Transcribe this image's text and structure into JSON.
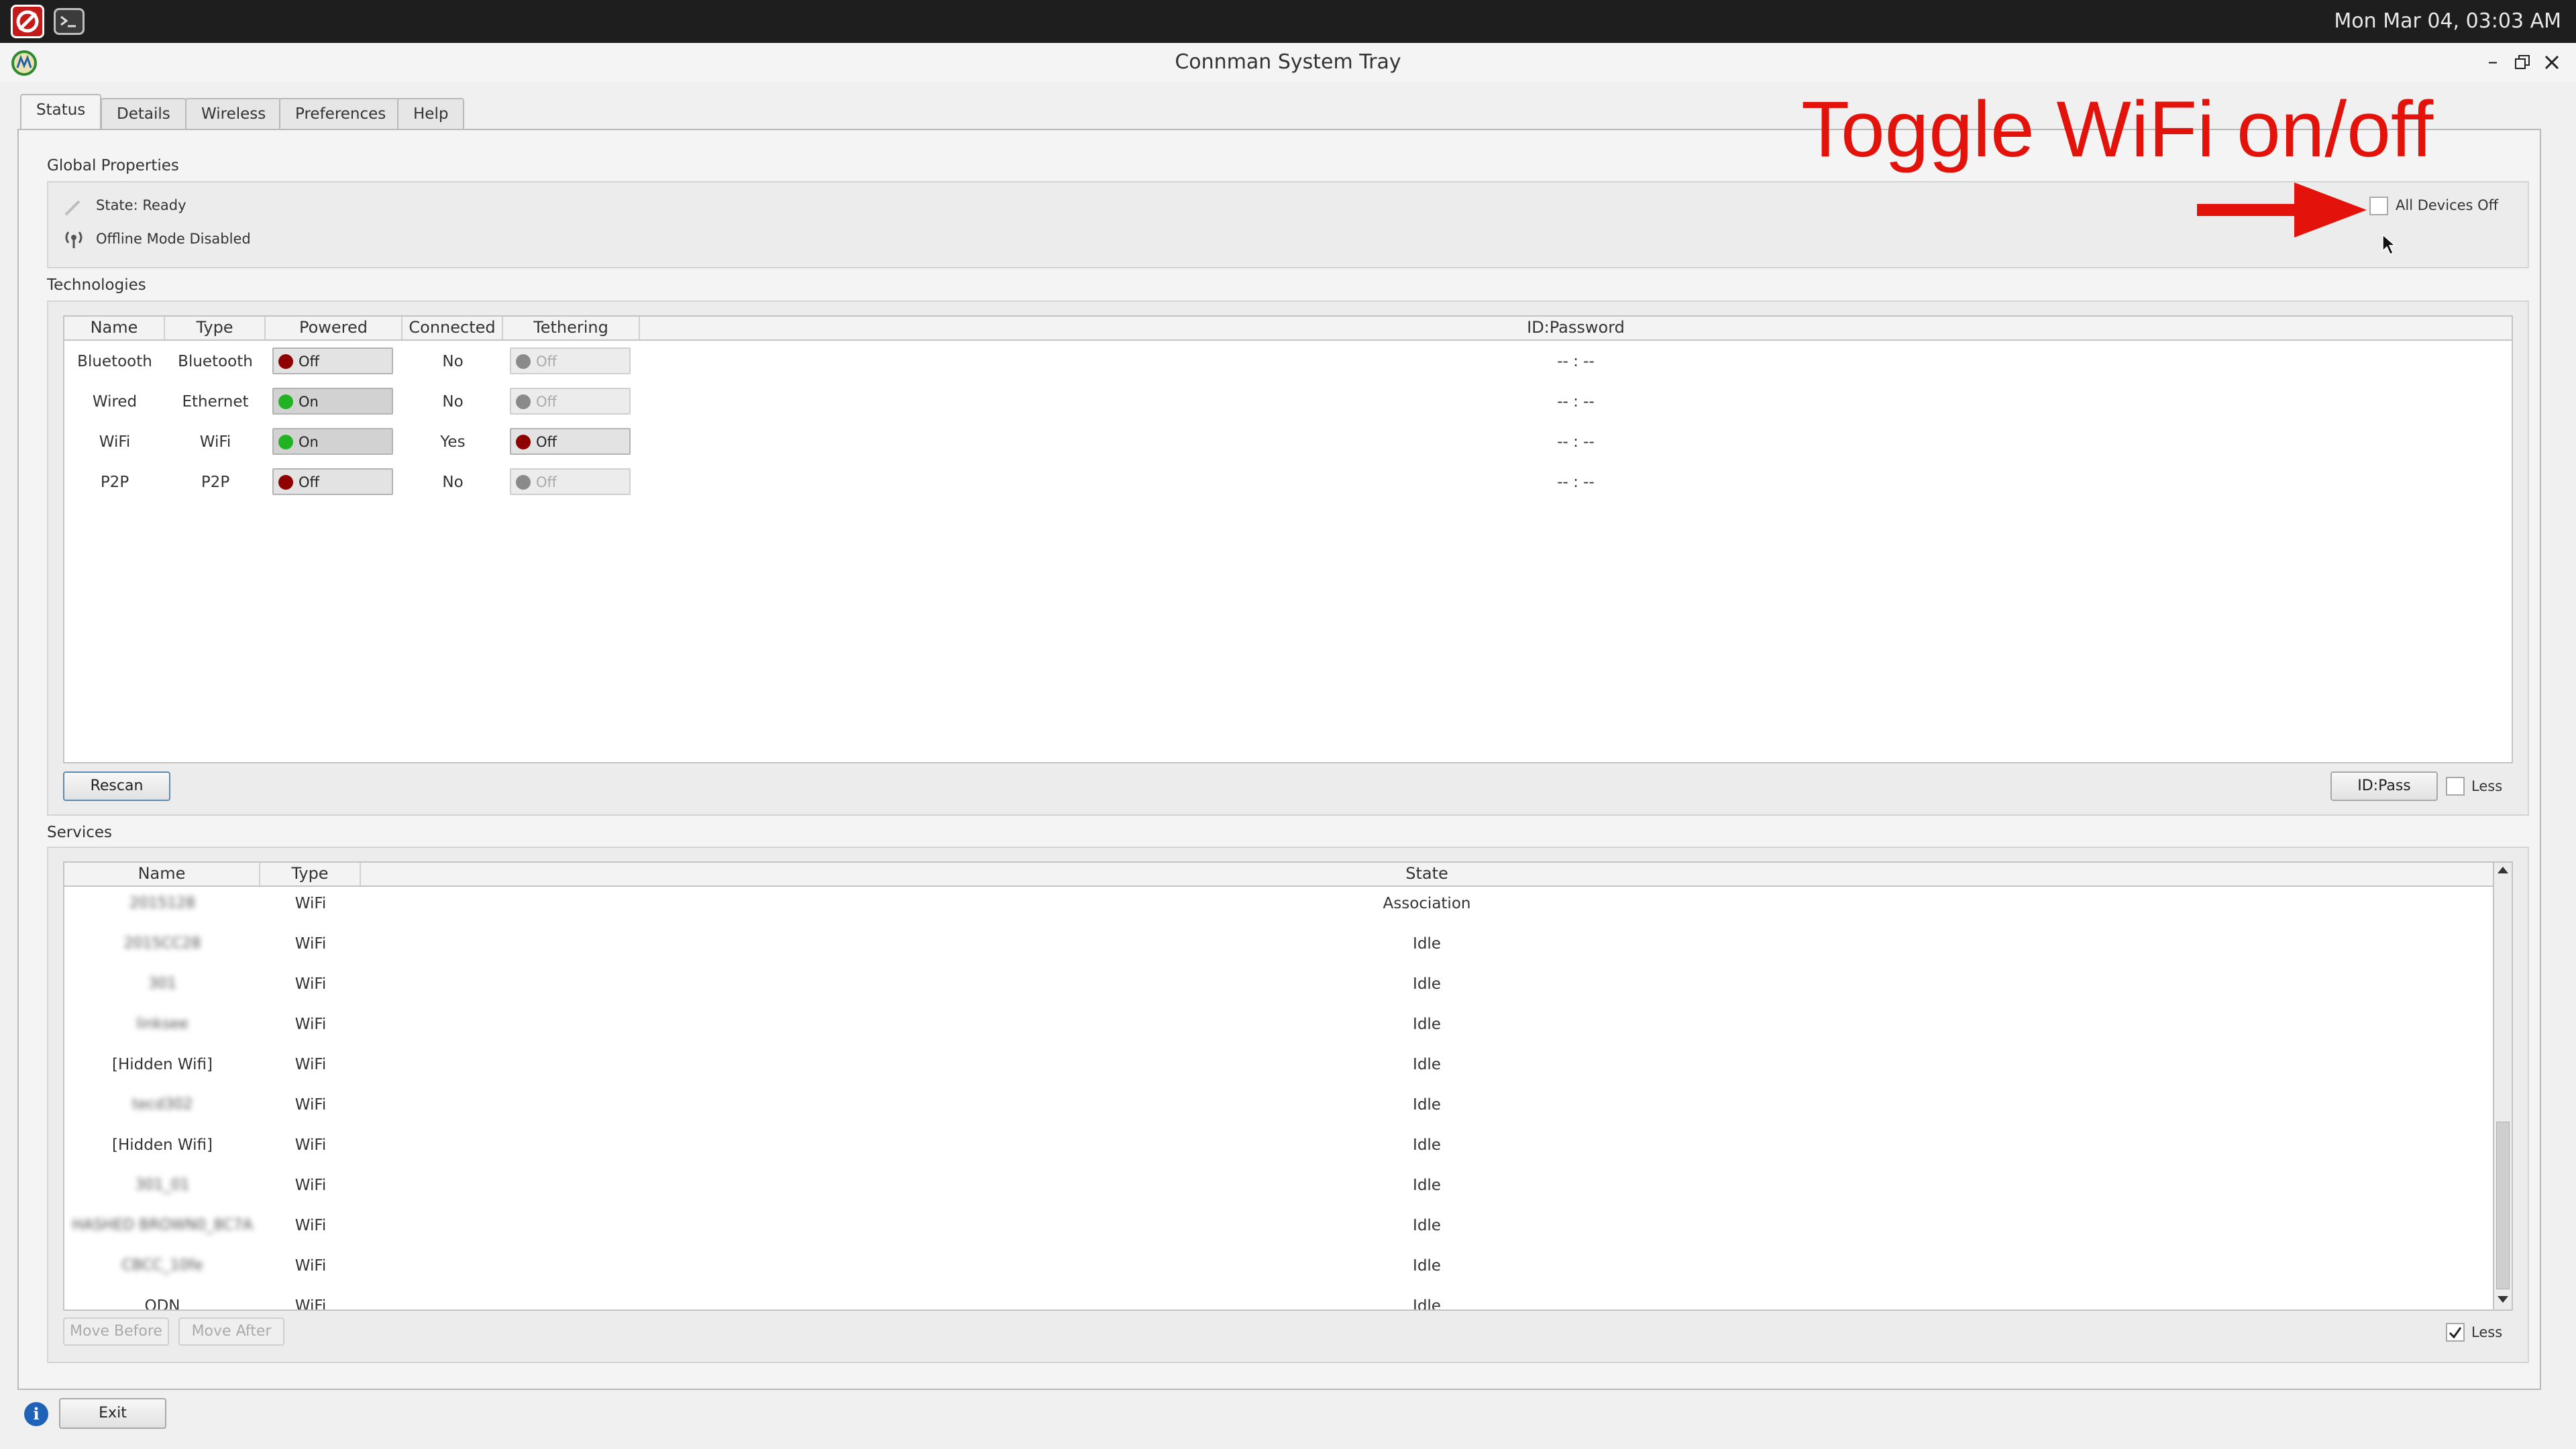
{
  "topbar": {
    "clock": "Mon Mar 04, 03:03 AM"
  },
  "window": {
    "title": "Connman System Tray"
  },
  "tabs": [
    {
      "label": "Status",
      "active": true
    },
    {
      "label": "Details"
    },
    {
      "label": "Wireless"
    },
    {
      "label": "Preferences"
    },
    {
      "label": "Help"
    }
  ],
  "annotation": {
    "text": "Toggle WiFi on/off",
    "color": "#e3120b"
  },
  "global_properties": {
    "title": "Global Properties",
    "state": "State: Ready",
    "offline": "Offline Mode Disabled",
    "all_devices_off": "All Devices Off"
  },
  "technologies": {
    "title": "Technologies",
    "columns": [
      "Name",
      "Type",
      "Powered",
      "Connected",
      "Tethering",
      "ID:Password"
    ],
    "rows": [
      {
        "name": "Bluetooth",
        "type": "Bluetooth",
        "powered": "Off",
        "connected": "No",
        "tethering": "Off",
        "idpass": "-- : --"
      },
      {
        "name": "Wired",
        "type": "Ethernet",
        "powered": "On",
        "connected": "No",
        "tethering": "Off",
        "idpass": "-- : --"
      },
      {
        "name": "WiFi",
        "type": "WiFi",
        "powered": "On",
        "connected": "Yes",
        "tethering": "Off",
        "idpass": "-- : --"
      },
      {
        "name": "P2P",
        "type": "P2P",
        "powered": "Off",
        "connected": "No",
        "tethering": "Off",
        "idpass": "-- : --"
      }
    ],
    "rescan": "Rescan",
    "idpass_button": "ID:Pass",
    "less": "Less"
  },
  "services": {
    "title": "Services",
    "columns": [
      "Name",
      "Type",
      "State"
    ],
    "rows": [
      {
        "name": "2015128",
        "type": "WiFi",
        "state": "Association"
      },
      {
        "name": "2015CC28",
        "type": "WiFi",
        "state": "Idle"
      },
      {
        "name": "301",
        "type": "WiFi",
        "state": "Idle"
      },
      {
        "name": "linksee",
        "type": "WiFi",
        "state": "Idle"
      },
      {
        "name": "[Hidden Wifi]",
        "type": "WiFi",
        "state": "Idle"
      },
      {
        "name": "tecd302",
        "type": "WiFi",
        "state": "Idle"
      },
      {
        "name": "[Hidden Wifi]",
        "type": "WiFi",
        "state": "Idle"
      },
      {
        "name": "301_01",
        "type": "WiFi",
        "state": "Idle"
      },
      {
        "name": "HASHED BROWN0_8C7A",
        "type": "WiFi",
        "state": "Idle"
      },
      {
        "name": "CBCC_10fe",
        "type": "WiFi",
        "state": "Idle"
      },
      {
        "name": "ODN",
        "type": "WiFi",
        "state": "Idle"
      }
    ],
    "move_before": "Move Before",
    "move_after": "Move After",
    "less": "Less"
  },
  "footer": {
    "exit": "Exit"
  },
  "colors": {
    "on": "#22b322",
    "off": "#8f0000",
    "disabled": "#8a8a8a"
  }
}
